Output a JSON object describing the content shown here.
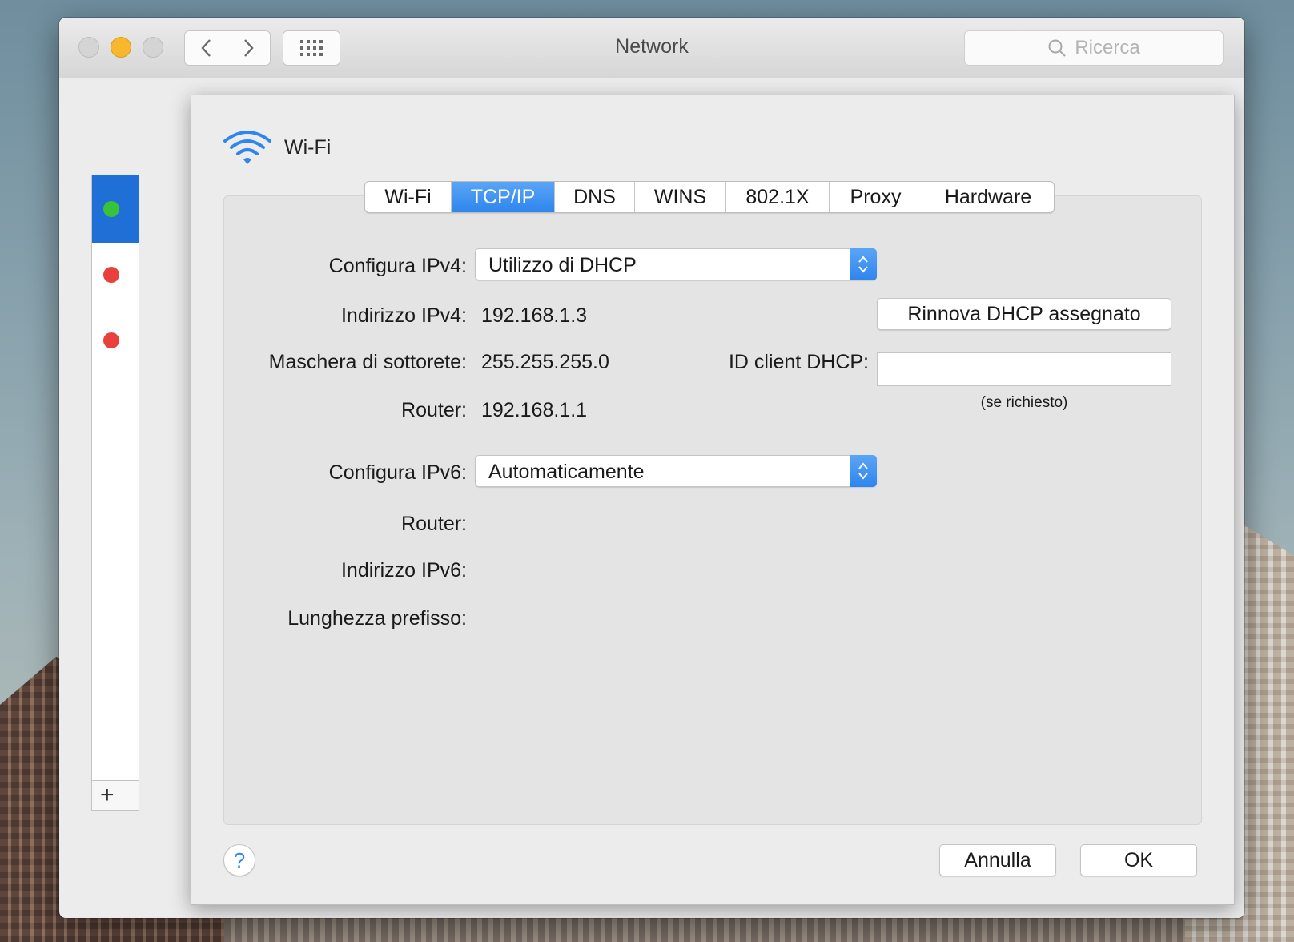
{
  "window": {
    "title": "Network",
    "search_placeholder": "Ricerca",
    "add_label": "+"
  },
  "sheet": {
    "interface_name": "Wi-Fi",
    "tabs": [
      {
        "label": "Wi-Fi",
        "active": false
      },
      {
        "label": "TCP/IP",
        "active": true
      },
      {
        "label": "DNS",
        "active": false
      },
      {
        "label": "WINS",
        "active": false
      },
      {
        "label": "802.1X",
        "active": false
      },
      {
        "label": "Proxy",
        "active": false
      },
      {
        "label": "Hardware",
        "active": false
      }
    ],
    "ipv4": {
      "configure_label": "Configura IPv4:",
      "configure_value": "Utilizzo di DHCP",
      "address_label": "Indirizzo IPv4:",
      "address_value": "192.168.1.3",
      "subnet_label": "Maschera di sottorete:",
      "subnet_value": "255.255.255.0",
      "router_label": "Router:",
      "router_value": "192.168.1.1",
      "renew_button": "Rinnova DHCP assegnato",
      "client_id_label": "ID client DHCP:",
      "client_id_value": "",
      "client_id_hint": "(se richiesto)"
    },
    "ipv6": {
      "configure_label": "Configura IPv6:",
      "configure_value": "Automaticamente",
      "router_label": "Router:",
      "address_label": "Indirizzo IPv6:",
      "prefix_label": "Lunghezza prefisso:"
    },
    "help_label": "?",
    "cancel_button": "Annulla",
    "ok_button": "OK"
  },
  "colors": {
    "accent": "#2f85ee",
    "status_connected": "#38c43a",
    "status_disconnected": "#e8413b",
    "minimize": "#f7b82e"
  },
  "icons": [
    "wifi-icon",
    "search-icon",
    "chevron-left-icon",
    "chevron-right-icon",
    "grid-icon",
    "updown-arrows-icon",
    "help-icon",
    "plus-icon"
  ]
}
